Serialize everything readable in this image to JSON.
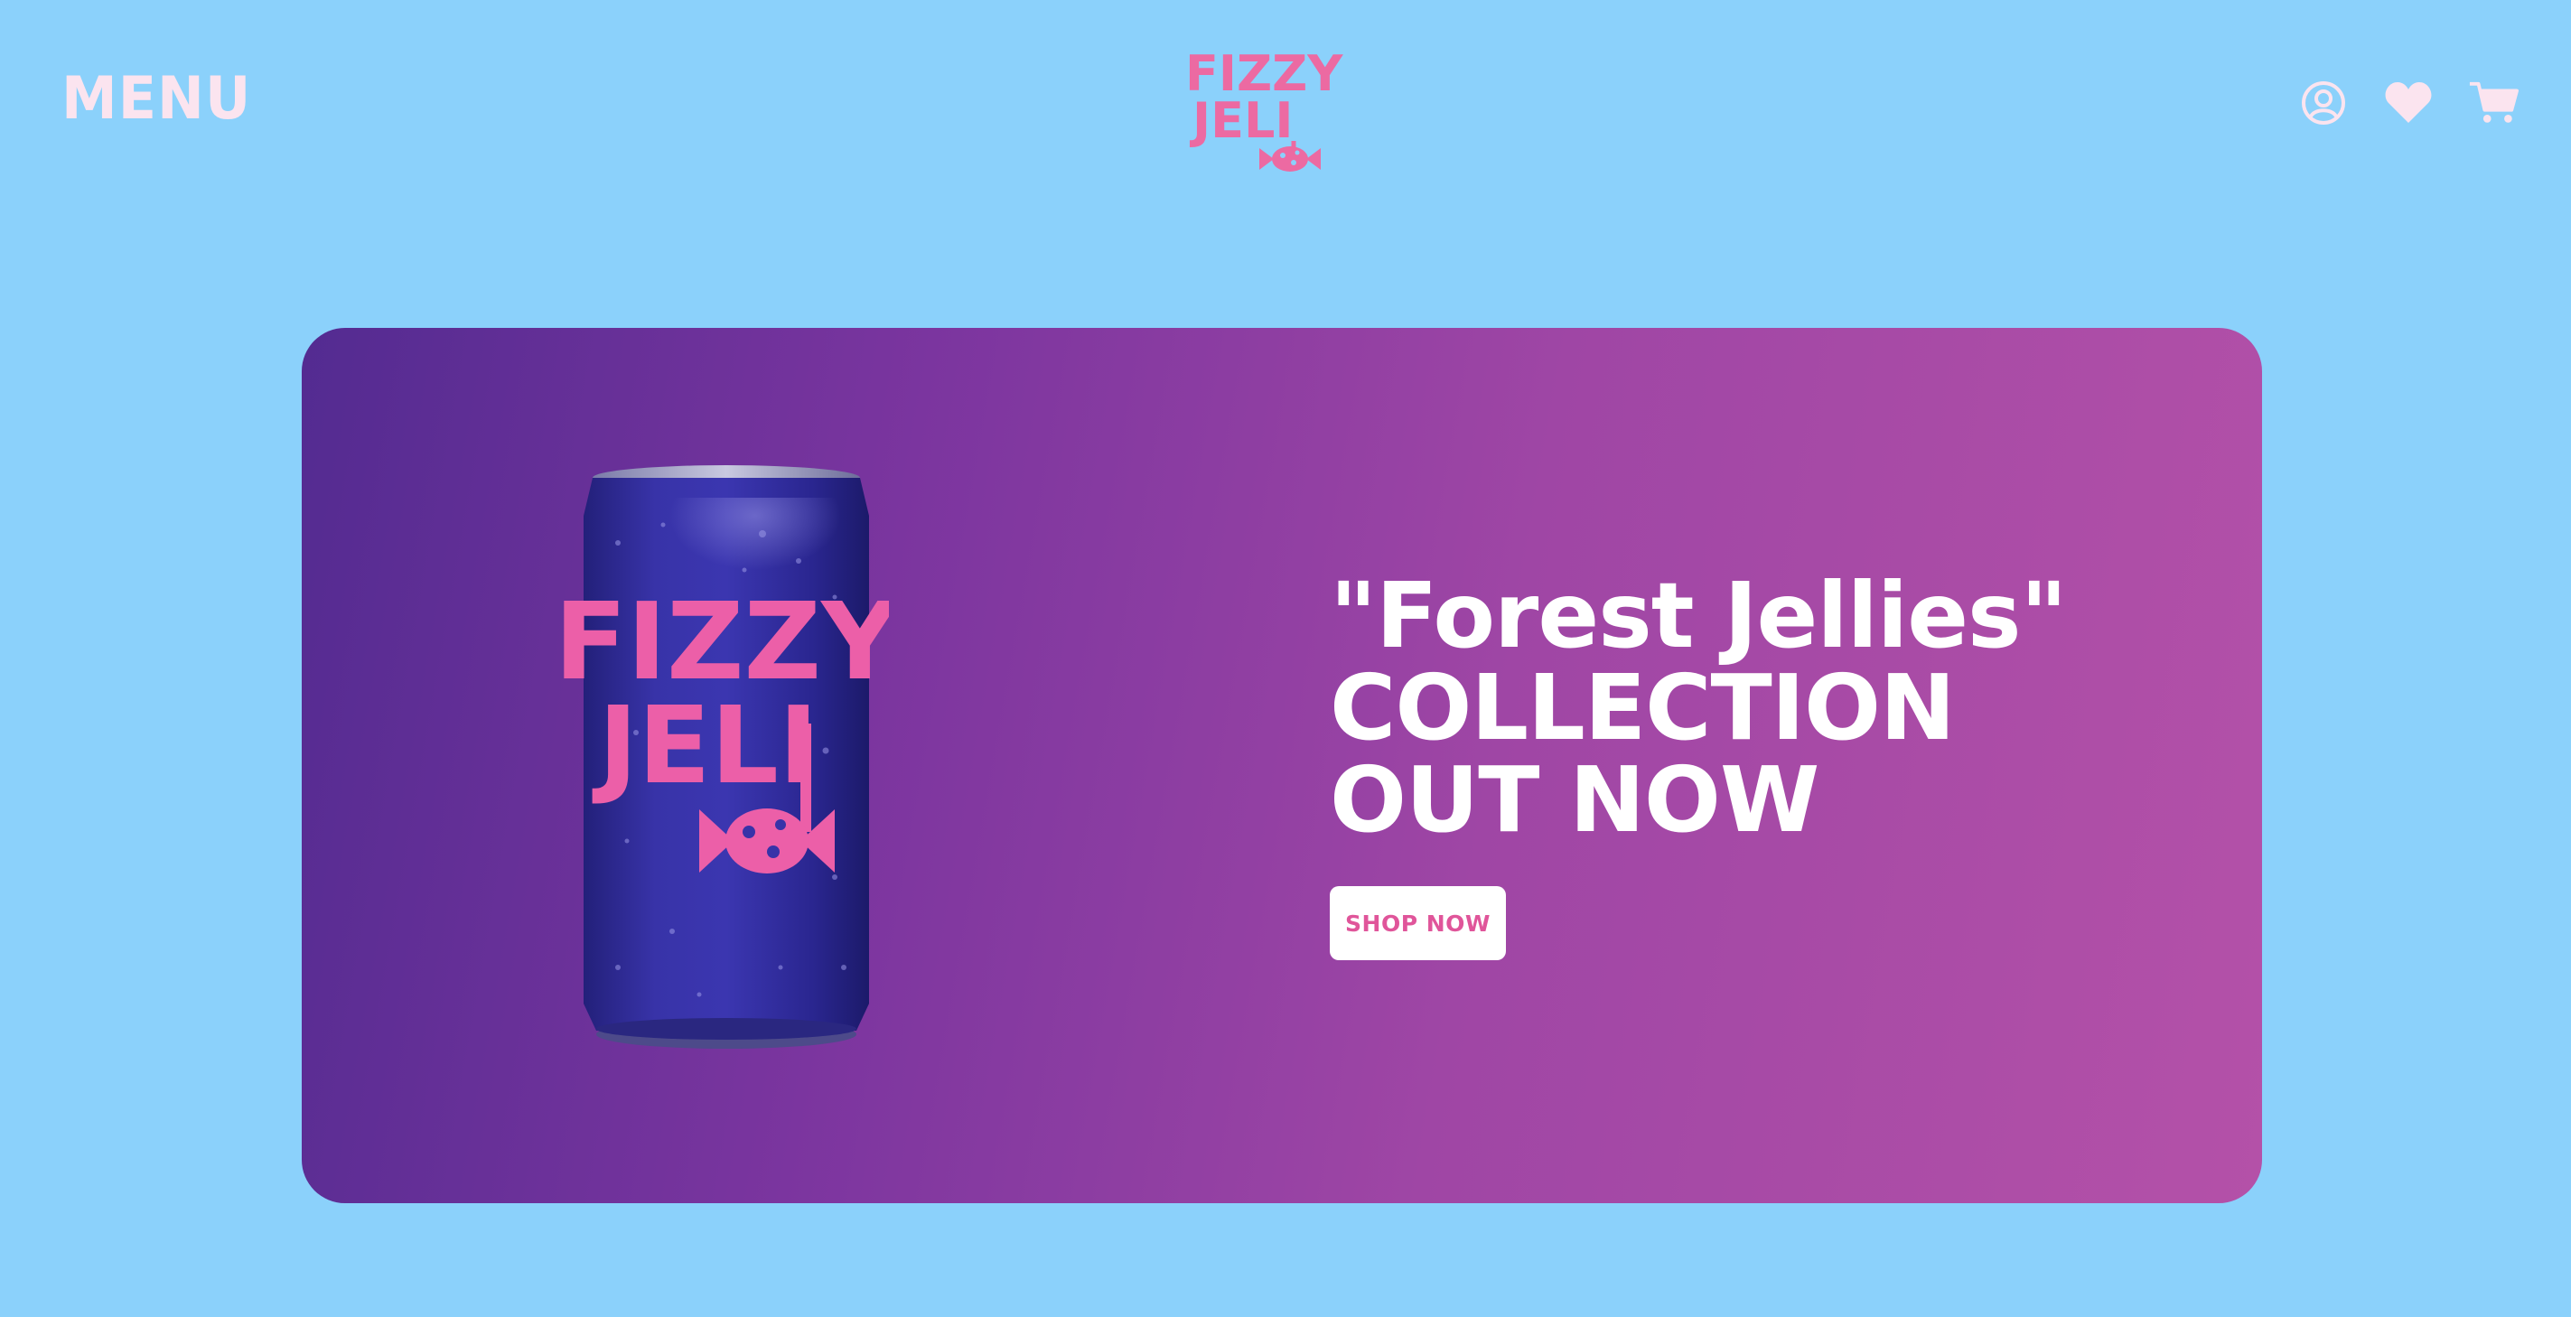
{
  "header": {
    "menu_label": "MENU",
    "logo": {
      "line1": "FIZZY",
      "line2": "JELI"
    },
    "icons": [
      "account-icon",
      "heart-icon",
      "cart-icon"
    ]
  },
  "hero": {
    "headline": [
      "\"Forest Jellies\"",
      "COLLECTION",
      "OUT NOW"
    ],
    "cta_label": "SHOP NOW",
    "product": {
      "brand_line1": "FIZZY",
      "brand_line2": "JELI"
    }
  },
  "colors": {
    "page_background": "#8bd1fb",
    "brand_pink": "#ec6aa2",
    "menu_text": "#fbe4ef",
    "hero_gradient_start": "#532b91",
    "hero_gradient_end": "#b451a8",
    "can_body": "#2c2a8f",
    "cta_text": "#e0559a"
  }
}
